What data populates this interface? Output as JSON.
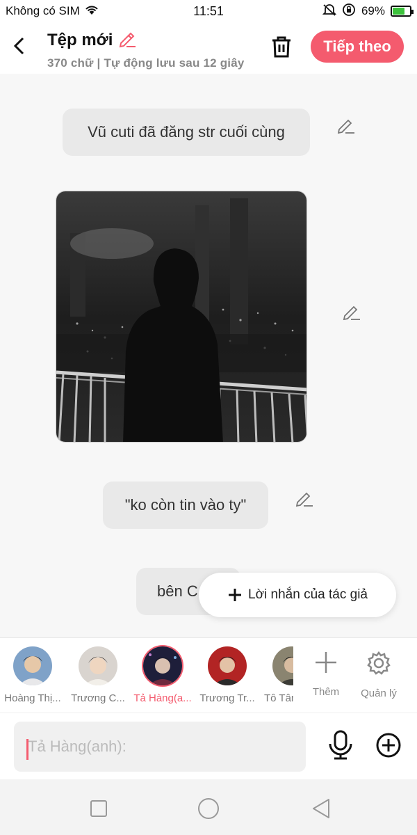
{
  "status_bar": {
    "carrier": "Không có SIM",
    "time": "11:51",
    "battery": "69%",
    "battery_level": 0.69
  },
  "header": {
    "title": "Tệp mới",
    "subtitle": "370 chữ | Tự động lưu sau 12 giây",
    "next_label": "Tiếp theo"
  },
  "messages": [
    {
      "text": "Vũ cuti đã đăng str cuối cùng"
    },
    {
      "type": "image"
    },
    {
      "text": "\"ko còn tin vào ty\""
    },
    {
      "text": "bên C"
    }
  ],
  "popup": {
    "label": "Lời nhắn của tác giả"
  },
  "characters": [
    {
      "name": "Hoàng Thị..."
    },
    {
      "name": "Trương C..."
    },
    {
      "name": "Tả Hàng(a...",
      "active": true
    },
    {
      "name": "Trương Tr..."
    },
    {
      "name": "Tô Tân"
    }
  ],
  "tools": {
    "add_label": "Thêm",
    "manage_label": "Quản lý"
  },
  "input": {
    "placeholder": "Tả Hàng(anh):"
  },
  "colors": {
    "accent": "#f45b6e",
    "bubble": "#e9e9e9",
    "background": "#f7f7f7"
  }
}
